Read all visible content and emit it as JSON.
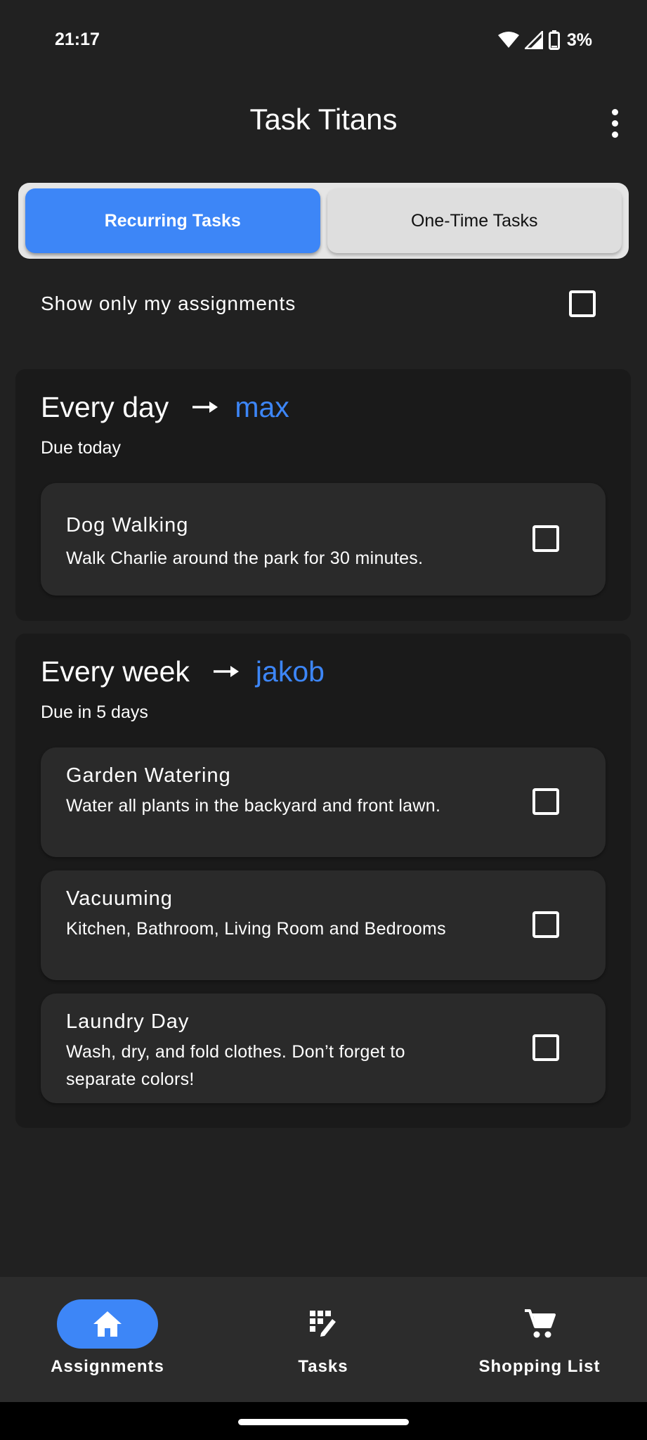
{
  "status_bar": {
    "time": "21:17",
    "battery": "3%",
    "icons": [
      "wifi-icon",
      "cell-signal-icon",
      "battery-icon"
    ]
  },
  "app_bar": {
    "title": "Task Titans",
    "menu_icon": "more-vert-icon"
  },
  "tabs": [
    {
      "label": "Recurring Tasks",
      "active": true
    },
    {
      "label": "One-Time Tasks",
      "active": false
    }
  ],
  "filter": {
    "label": "Show only my assignments",
    "checked": false
  },
  "groups": [
    {
      "frequency": "Every day",
      "assignee": "max",
      "due": "Due today",
      "tasks": [
        {
          "title": "Dog Walking",
          "description": "Walk Charlie around the park for 30 minutes.",
          "checked": false
        }
      ]
    },
    {
      "frequency": "Every week",
      "assignee": "jakob",
      "due": "Due in 5 days",
      "tasks": [
        {
          "title": "Garden Watering",
          "description": "Water all plants in the backyard and front lawn.",
          "checked": false
        },
        {
          "title": "Vacuuming",
          "description": "Kitchen, Bathroom, Living Room and Bedrooms",
          "checked": false
        },
        {
          "title": "Laundry Day",
          "description": "Wash, dry, and fold clothes. Don’t forget to separate colors!",
          "checked": false
        }
      ]
    }
  ],
  "bottom_nav": [
    {
      "label": "Assignments",
      "icon": "home-icon",
      "active": true
    },
    {
      "label": "Tasks",
      "icon": "tasks-icon",
      "active": false
    },
    {
      "label": "Shopping List",
      "icon": "cart-icon",
      "active": false
    }
  ],
  "colors": {
    "background": "#212121",
    "accent": "#3d86f7",
    "group_background": "#1a1a1a",
    "card_background": "#2a2a2a",
    "nav_background": "#2c2c2c"
  }
}
